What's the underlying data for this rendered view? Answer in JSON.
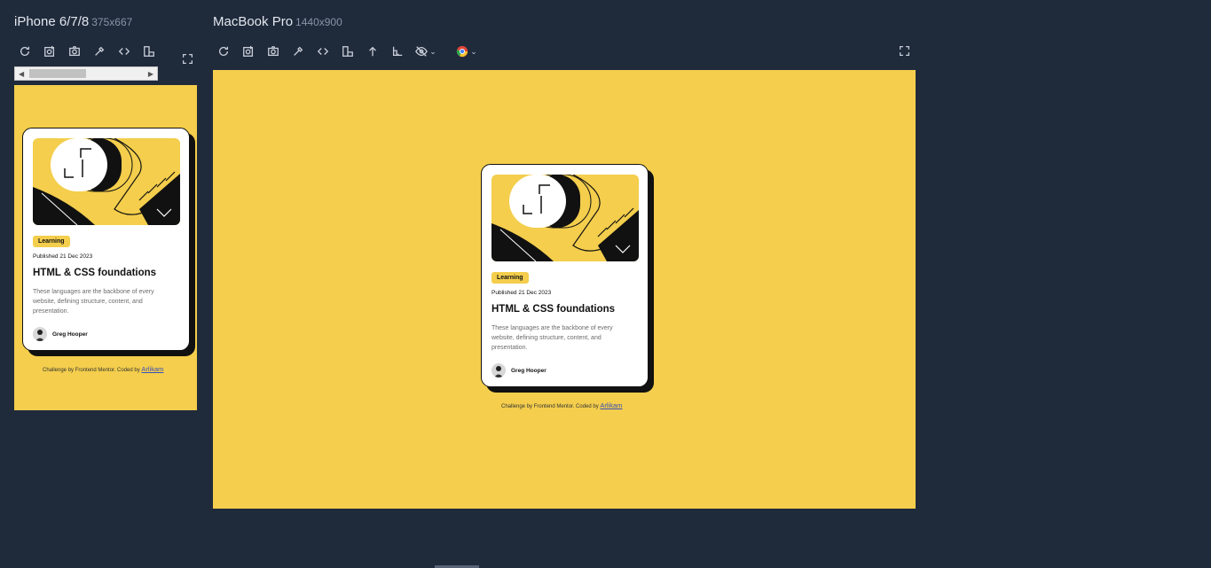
{
  "devices": [
    {
      "name": "iPhone 6/7/8",
      "size": "375x667",
      "toolbar": [
        "refresh-icon",
        "screenshot-full-icon",
        "camera-icon",
        "eyedropper-icon",
        "code-icon",
        "rotate-icon"
      ]
    },
    {
      "name": "MacBook Pro",
      "size": "1440x900",
      "toolbar": [
        "refresh-icon",
        "screenshot-full-icon",
        "camera-icon",
        "eyedropper-icon",
        "code-icon",
        "rotate-icon",
        "arrow-up-icon",
        "ruler-icon",
        "eye-off-icon",
        "chrome-icon"
      ]
    }
  ],
  "card": {
    "tag": "Learning",
    "published": "Published 21 Dec 2023",
    "title": "HTML & CSS foundations",
    "description": "These languages are the backbone of every website, defining structure, content, and presentation.",
    "author": "Greg Hooper"
  },
  "credit": {
    "text": "Challenge by Frontend Mentor. Coded by ",
    "link": "Arlikam"
  },
  "colors": {
    "background": "#1f2a3b",
    "screen": "#f4ce4c",
    "card": "#ffffff",
    "ink": "#111111"
  }
}
